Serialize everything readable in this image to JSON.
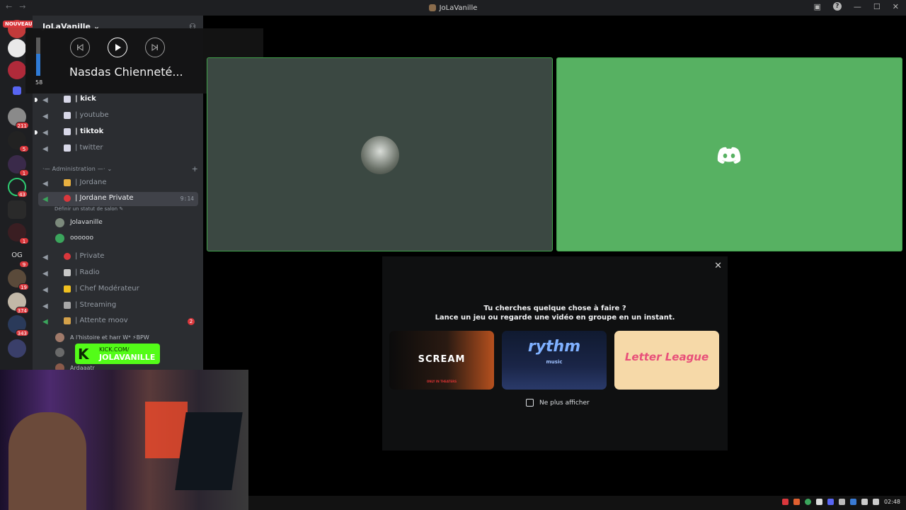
{
  "window": {
    "title": "JoLaVanille",
    "nav_back": "←",
    "nav_forward": "→",
    "controls": {
      "minimize": "—",
      "maximize": "☐",
      "close": "✕"
    }
  },
  "guilds": {
    "new_label": "NOUVEAU",
    "badges": [
      "211",
      "5",
      "1",
      "43",
      "1",
      "9",
      "19",
      "374",
      "343"
    ],
    "og_label": "OG"
  },
  "server": {
    "name": "JoLaVanille ⌄"
  },
  "channels": [
    {
      "label": "| kick",
      "unread": true
    },
    {
      "label": "| youtube",
      "unread": false
    },
    {
      "label": "| tiktok",
      "unread": true
    },
    {
      "label": "| twitter",
      "unread": false
    }
  ],
  "category": {
    "label": "·— Administration —·  ⌄"
  },
  "admin_channels": [
    {
      "label": "| Jordane"
    },
    {
      "label": "| Jordane Private",
      "timer": "9:14",
      "status": "Définir un statut de salon ✎"
    },
    {
      "label": "| Private"
    },
    {
      "label": "| Radio"
    },
    {
      "label": "| Chef Modérateur"
    },
    {
      "label": "| Streaming"
    },
    {
      "label": "| Attente moov",
      "mention": "2"
    }
  ],
  "voice_users": [
    "Jolavanille",
    "oooooo"
  ],
  "waiting_users": [
    "A l'histoire et harr W⁴ ⚡BPW",
    "",
    "Ardaaatr"
  ],
  "media": {
    "volume": 58,
    "volume_label": "58",
    "track": "Nasdas Chienneté..."
  },
  "kick": {
    "line1": "KICK.COM/",
    "line2": "JOLAVANILLE",
    "k": "K"
  },
  "activity": {
    "heading": "Tu cherches quelque chose à faire ?",
    "subheading": "Lance un jeu ou regarde une vidéo en groupe en un instant.",
    "cards": [
      "SCREAM",
      "rythm",
      "Letter League"
    ],
    "rythm_sub": "music",
    "scream_sub": "ONLY IN THEATERS",
    "checkbox_label": "Ne plus afficher"
  },
  "taskbar": {
    "clock": "02:48"
  },
  "colors": {
    "accent_green": "#57b162",
    "discord_red": "#da373c",
    "kick_green": "#53fc18"
  }
}
